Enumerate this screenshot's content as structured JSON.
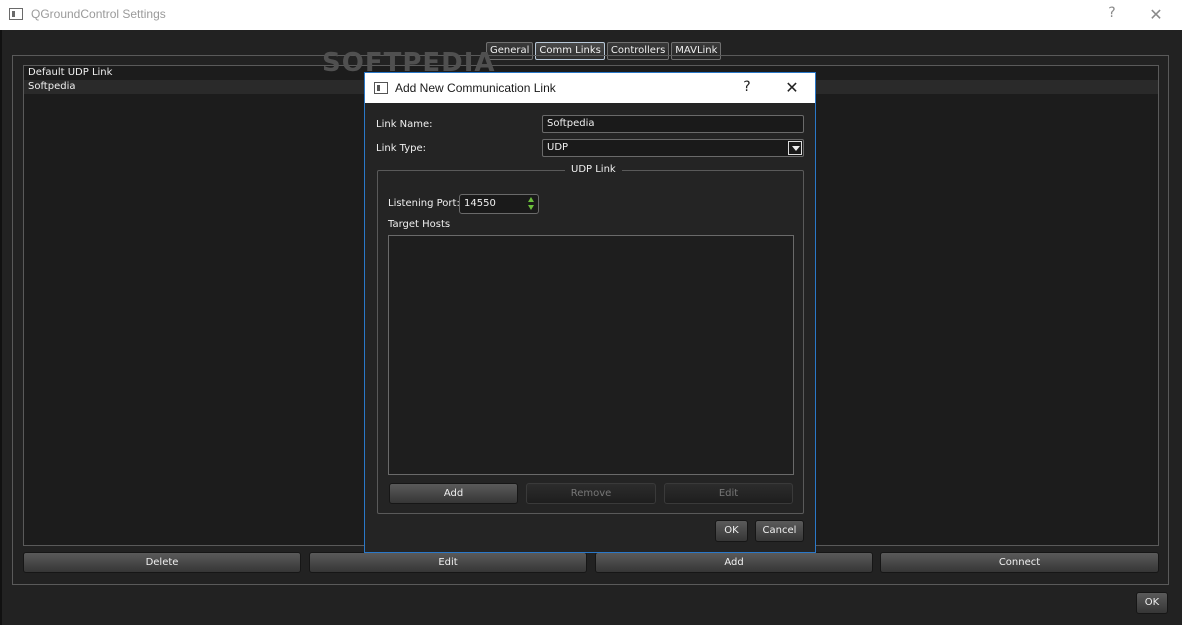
{
  "window": {
    "title": "QGroundControl Settings",
    "help_glyph": "?",
    "close_glyph": "✕"
  },
  "tabs": [
    {
      "label": "General",
      "active": false
    },
    {
      "label": "Comm Links",
      "active": true
    },
    {
      "label": "Controllers",
      "active": false
    },
    {
      "label": "MAVLink",
      "active": false
    }
  ],
  "links_list": {
    "items": [
      {
        "label": "Default UDP Link",
        "selected": false
      },
      {
        "label": "Softpedia",
        "selected": true
      }
    ]
  },
  "watermark": "SOFTPEDIA",
  "bottom_buttons": {
    "delete": "Delete",
    "edit": "Edit",
    "add": "Add",
    "connect": "Connect"
  },
  "ok_button": "OK",
  "dialog": {
    "title": "Add New Communication Link",
    "help_glyph": "?",
    "close_glyph": "✕",
    "link_name_label": "Link Name:",
    "link_name_value": "Softpedia",
    "link_type_label": "Link Type:",
    "link_type_value": "UDP",
    "udp_group": {
      "title": "UDP Link",
      "listening_port_label": "Listening Port:",
      "listening_port_value": "14550",
      "target_hosts_label": "Target Hosts",
      "target_hosts": [],
      "add_button": "Add",
      "remove_button": "Remove",
      "edit_button": "Edit"
    },
    "ok_button": "OK",
    "cancel_button": "Cancel"
  },
  "colors": {
    "background": "#222222",
    "dialog_border": "#2a78c8",
    "spin_arrows": "#6cbf3c"
  }
}
